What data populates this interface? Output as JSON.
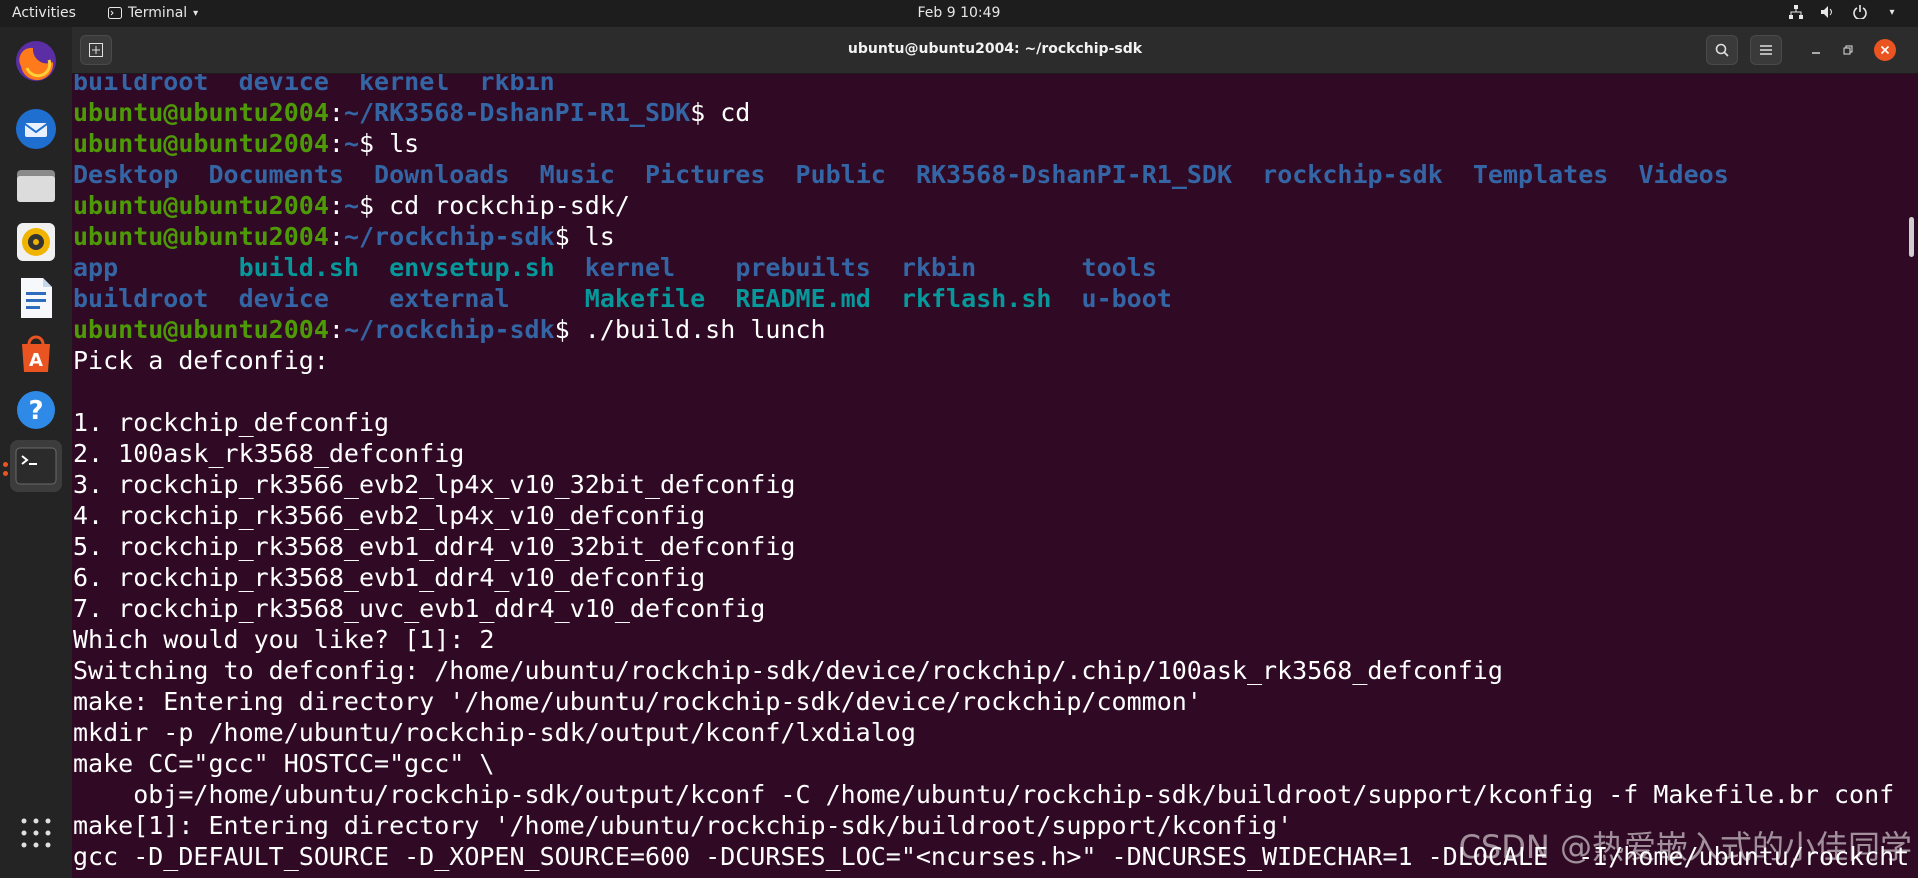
{
  "topbar": {
    "activities": "Activities",
    "app_name": "Terminal",
    "clock": "Feb 9  10:49"
  },
  "dock": {
    "apps": [
      {
        "name": "firefox-icon"
      },
      {
        "name": "thunderbird-icon"
      },
      {
        "name": "files-icon"
      },
      {
        "name": "rhythmbox-icon"
      },
      {
        "name": "libreoffice-writer-icon"
      },
      {
        "name": "ubuntu-software-icon"
      },
      {
        "name": "help-icon"
      },
      {
        "name": "terminal-icon"
      }
    ]
  },
  "window": {
    "title": "ubuntu@ubuntu2004: ~/rockchip-sdk"
  },
  "terminal": {
    "lines": [
      [
        {
          "t": "buildroot",
          "c": "d"
        },
        {
          "t": "  "
        },
        {
          "t": "device",
          "c": "d"
        },
        {
          "t": "  "
        },
        {
          "t": "kernel",
          "c": "d"
        },
        {
          "t": "  "
        },
        {
          "t": "rkbin",
          "c": "d"
        }
      ],
      [
        {
          "t": "ubuntu@ubuntu2004",
          "c": "u"
        },
        {
          "t": ":"
        },
        {
          "t": "~/RK3568-DshanPI-R1_SDK",
          "c": "p"
        },
        {
          "t": "$ cd"
        }
      ],
      [
        {
          "t": "ubuntu@ubuntu2004",
          "c": "u"
        },
        {
          "t": ":"
        },
        {
          "t": "~",
          "c": "p"
        },
        {
          "t": "$ ls"
        }
      ],
      [
        {
          "t": "Desktop",
          "c": "d"
        },
        {
          "t": "  "
        },
        {
          "t": "Documents",
          "c": "d"
        },
        {
          "t": "  "
        },
        {
          "t": "Downloads",
          "c": "d"
        },
        {
          "t": "  "
        },
        {
          "t": "Music",
          "c": "d"
        },
        {
          "t": "  "
        },
        {
          "t": "Pictures",
          "c": "d"
        },
        {
          "t": "  "
        },
        {
          "t": "Public",
          "c": "d"
        },
        {
          "t": "  "
        },
        {
          "t": "RK3568-DshanPI-R1_SDK",
          "c": "d"
        },
        {
          "t": "  "
        },
        {
          "t": "rockchip-sdk",
          "c": "d"
        },
        {
          "t": "  "
        },
        {
          "t": "Templates",
          "c": "d"
        },
        {
          "t": "  "
        },
        {
          "t": "Videos",
          "c": "d"
        }
      ],
      [
        {
          "t": "ubuntu@ubuntu2004",
          "c": "u"
        },
        {
          "t": ":"
        },
        {
          "t": "~",
          "c": "p"
        },
        {
          "t": "$ cd rockchip-sdk/"
        }
      ],
      [
        {
          "t": "ubuntu@ubuntu2004",
          "c": "u"
        },
        {
          "t": ":"
        },
        {
          "t": "~/rockchip-sdk",
          "c": "p"
        },
        {
          "t": "$ ls"
        }
      ],
      [
        {
          "t": "app",
          "c": "d"
        },
        {
          "t": "        "
        },
        {
          "t": "build.sh",
          "c": "x"
        },
        {
          "t": "  "
        },
        {
          "t": "envsetup.sh",
          "c": "x"
        },
        {
          "t": "  "
        },
        {
          "t": "kernel",
          "c": "d"
        },
        {
          "t": "    "
        },
        {
          "t": "prebuilts",
          "c": "d"
        },
        {
          "t": "  "
        },
        {
          "t": "rkbin",
          "c": "d"
        },
        {
          "t": "       "
        },
        {
          "t": "tools",
          "c": "d"
        }
      ],
      [
        {
          "t": "buildroot",
          "c": "d"
        },
        {
          "t": "  "
        },
        {
          "t": "device",
          "c": "d"
        },
        {
          "t": "    "
        },
        {
          "t": "external",
          "c": "d"
        },
        {
          "t": "     "
        },
        {
          "t": "Makefile",
          "c": "x"
        },
        {
          "t": "  "
        },
        {
          "t": "README.md",
          "c": "x"
        },
        {
          "t": "  "
        },
        {
          "t": "rkflash.sh",
          "c": "x"
        },
        {
          "t": "  "
        },
        {
          "t": "u-boot",
          "c": "d"
        }
      ],
      [
        {
          "t": "ubuntu@ubuntu2004",
          "c": "u"
        },
        {
          "t": ":"
        },
        {
          "t": "~/rockchip-sdk",
          "c": "p"
        },
        {
          "t": "$ ./build.sh lunch"
        }
      ],
      [
        {
          "t": "Pick a defconfig:"
        }
      ],
      [
        {
          "t": ""
        }
      ],
      [
        {
          "t": "1. rockchip_defconfig"
        }
      ],
      [
        {
          "t": "2. 100ask_rk3568_defconfig"
        }
      ],
      [
        {
          "t": "3. rockchip_rk3566_evb2_lp4x_v10_32bit_defconfig"
        }
      ],
      [
        {
          "t": "4. rockchip_rk3566_evb2_lp4x_v10_defconfig"
        }
      ],
      [
        {
          "t": "5. rockchip_rk3568_evb1_ddr4_v10_32bit_defconfig"
        }
      ],
      [
        {
          "t": "6. rockchip_rk3568_evb1_ddr4_v10_defconfig"
        }
      ],
      [
        {
          "t": "7. rockchip_rk3568_uvc_evb1_ddr4_v10_defconfig"
        }
      ],
      [
        {
          "t": "Which would you like? [1]: 2"
        }
      ],
      [
        {
          "t": "Switching to defconfig: /home/ubuntu/rockchip-sdk/device/rockchip/.chip/100ask_rk3568_defconfig"
        }
      ],
      [
        {
          "t": "make: Entering directory '/home/ubuntu/rockchip-sdk/device/rockchip/common'"
        }
      ],
      [
        {
          "t": "mkdir -p /home/ubuntu/rockchip-sdk/output/kconf/lxdialog"
        }
      ],
      [
        {
          "t": "make CC=\"gcc\" HOSTCC=\"gcc\" \\"
        }
      ],
      [
        {
          "t": "    obj=/home/ubuntu/rockchip-sdk/output/kconf -C /home/ubuntu/rockchip-sdk/buildroot/support/kconfig -f Makefile.br conf"
        }
      ],
      [
        {
          "t": "make[1]: Entering directory '/home/ubuntu/rockchip-sdk/buildroot/support/kconfig'"
        }
      ],
      [
        {
          "t": "gcc -D_DEFAULT_SOURCE -D_XOPEN_SOURCE=600 -DCURSES_LOC=\"<ncurses.h>\" -DNCURSES_WIDECHAR=1 -DLOCALE  -I/home/ubuntu/rockcht"
        }
      ]
    ]
  },
  "watermark": "CSDN @热爱嵌入式的小佳同学"
}
